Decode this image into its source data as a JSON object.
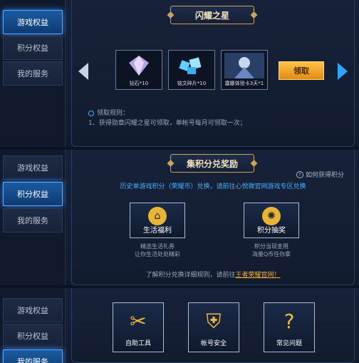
{
  "panel1": {
    "sidebar": [
      "游戏权益",
      "积分权益",
      "我的服务"
    ],
    "banner": "闪耀之星",
    "rewards": [
      {
        "icon": "diamond-icon",
        "label": "钻石*10"
      },
      {
        "icon": "crystal-fragments-icon",
        "label": "铭文碎片*10"
      },
      {
        "icon": "hero-skin-card-icon",
        "label": "露娜体验卡3天*1"
      }
    ],
    "claim": "领取",
    "rules_title": "领取规则：",
    "rules_text": "1、获得勋章闪耀之星可领取，单帐号每月可领取一次；"
  },
  "panel2": {
    "sidebar": [
      "游戏权益",
      "积分权益",
      "我的服务"
    ],
    "banner": "集积分兑奖励",
    "help": "如何获得积分",
    "note": "历史单游戏积分（荣耀币）兑换，请前往心悦微官网游戏专区兑换",
    "features": [
      {
        "icon": "gift-home-icon",
        "label": "生活福利",
        "desc1": "精选生活礼券",
        "desc2": "让你生活处处精彩"
      },
      {
        "icon": "lottery-wheel-icon",
        "label": "积分抽奖",
        "desc1": "积分当现金用",
        "desc2": "海量Q币任你拿"
      }
    ],
    "footer_prefix": "了解积分兑换详细规则，请前往",
    "footer_link": "王者荣耀官网！"
  },
  "panel3": {
    "sidebar": [
      "游戏权益",
      "积分权益",
      "我的服务"
    ],
    "services": [
      {
        "icon": "tools-icon",
        "label": "自助工具"
      },
      {
        "icon": "shield-icon",
        "label": "帐号安全"
      },
      {
        "icon": "question-icon",
        "label": "常见问题"
      }
    ]
  },
  "colors": {
    "accent": "#2ea6ff",
    "gold": "#c9a45a",
    "claim": "#f0a020"
  }
}
